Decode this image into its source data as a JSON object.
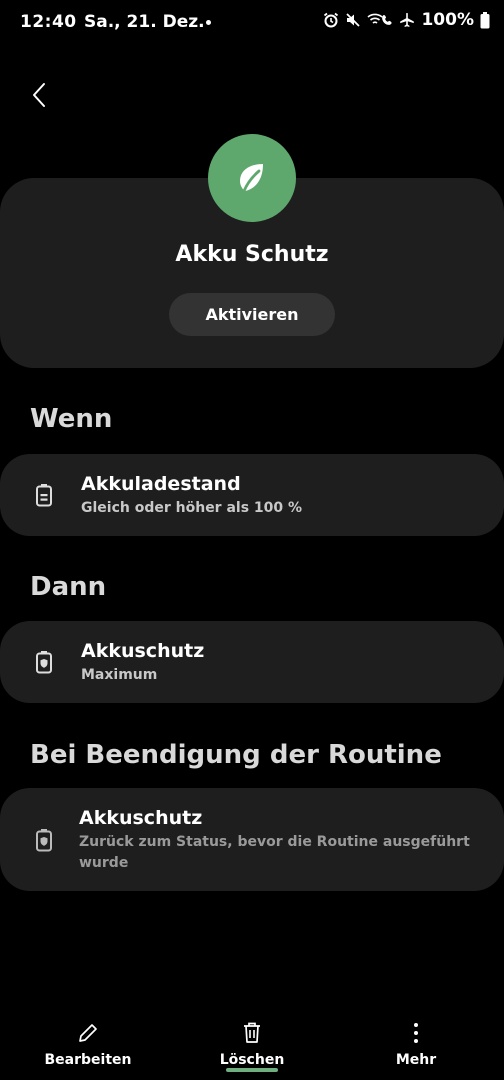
{
  "status_bar": {
    "time": "12:40",
    "date": "Sa., 21. Dez.",
    "battery": "100%",
    "icons": [
      "alarm-icon",
      "mute-icon",
      "wifi-calling-icon",
      "airplane-icon",
      "battery-icon"
    ]
  },
  "header": {
    "title": "Akku Schutz",
    "activate_label": "Aktivieren",
    "icon": "leaf-icon",
    "icon_bg": "#5fa86d"
  },
  "sections": {
    "when": {
      "title": "Wenn",
      "item": {
        "title": "Akkuladestand",
        "subtitle": "Gleich oder höher als 100 %",
        "icon": "battery-level-icon"
      }
    },
    "then": {
      "title": "Dann",
      "item": {
        "title": "Akkuschutz",
        "subtitle": "Maximum",
        "icon": "battery-shield-icon"
      }
    },
    "on_end": {
      "title": "Bei Beendigung der Routine",
      "item": {
        "title": "Akkuschutz",
        "subtitle": "Zurück zum Status, bevor die Routine ausgeführt wurde",
        "icon": "battery-shield-icon"
      }
    }
  },
  "bottom_nav": {
    "edit": "Bearbeiten",
    "delete": "Löschen",
    "more": "Mehr",
    "accent": "#6fae7e"
  }
}
